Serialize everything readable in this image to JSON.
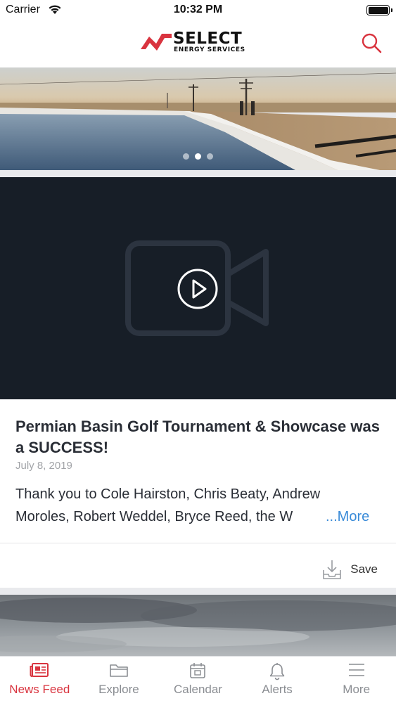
{
  "status_bar": {
    "carrier": "Carrier",
    "time": "10:32 PM"
  },
  "header": {
    "logo_word": "SELECT",
    "logo_subtitle": "ENERGY SERVICES",
    "search_icon": "search-icon"
  },
  "carousel": {
    "slide_count": 3,
    "active_index": 1
  },
  "post": {
    "title": "Permian Basin Golf Tournament & Showcase was a SUCCESS!",
    "date": "July 8, 2019",
    "body_line1": "Thank you to Cole Hairston, Chris Beaty, Andrew",
    "body_line2": "Moroles, Robert Weddel, Bryce Reed, the W",
    "more_label": "...More",
    "save_label": "Save"
  },
  "tabs": [
    {
      "label": "News Feed",
      "icon": "newspaper-icon",
      "active": true
    },
    {
      "label": "Explore",
      "icon": "folder-icon",
      "active": false
    },
    {
      "label": "Calendar",
      "icon": "calendar-icon",
      "active": false
    },
    {
      "label": "Alerts",
      "icon": "bell-icon",
      "active": false
    },
    {
      "label": "More",
      "icon": "menu-icon",
      "active": false
    }
  ],
  "colors": {
    "accent": "#d9343f",
    "link": "#3a8bd8",
    "video_bg": "#171e27",
    "inactive_tab": "#8a8d92"
  }
}
